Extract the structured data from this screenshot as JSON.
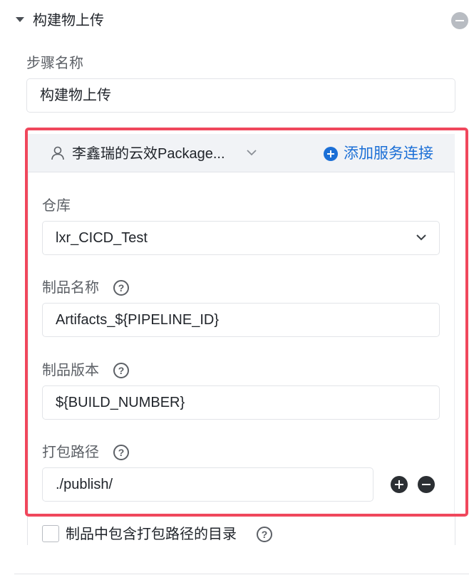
{
  "section": {
    "title": "构建物上传"
  },
  "step_name": {
    "label": "步骤名称",
    "value": "构建物上传"
  },
  "connection": {
    "name": "李鑫瑞的云效Package...",
    "add_label": "添加服务连接"
  },
  "repository": {
    "label": "仓库",
    "value": "lxr_CICD_Test"
  },
  "artifact_name": {
    "label": "制品名称",
    "value": "Artifacts_${PIPELINE_ID}"
  },
  "artifact_version": {
    "label": "制品版本",
    "value": "${BUILD_NUMBER}"
  },
  "package_path": {
    "label": "打包路径",
    "value": "./publish/"
  },
  "include_dir": {
    "label": "制品中包含打包路径的目录",
    "checked": false
  },
  "help_glyph": "?",
  "colors": {
    "accent": "#1b6fd6",
    "highlight": "#f0475c"
  }
}
